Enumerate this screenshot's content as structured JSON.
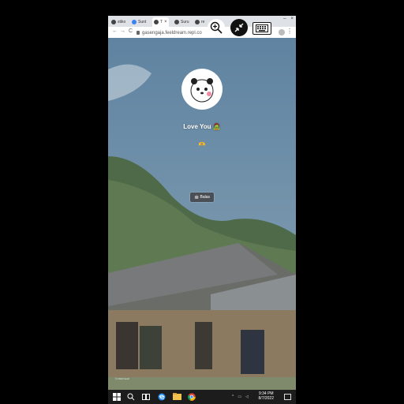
{
  "browser": {
    "tabs": [
      {
        "label": "stiko",
        "icon": "github-icon"
      },
      {
        "label": "Sunt",
        "icon": "chrome-icon"
      },
      {
        "label": "T",
        "icon": "replit-icon",
        "active": true
      },
      {
        "label": "Suru",
        "icon": "replit-icon"
      },
      {
        "label": "re",
        "icon": "replit-icon"
      }
    ],
    "address": "gasengaja.feeldream.repl.co",
    "nav": {
      "back": "←",
      "forward": "→",
      "reload": "C"
    }
  },
  "profile": {
    "name": "Love You 🧟",
    "emoji_line": "🫶",
    "link_button": "🤖 Balas"
  },
  "page": {
    "credit": "© 2022 Kasih"
  },
  "taskbar": {
    "time": "9:34 PM",
    "date": "8/7/2022"
  },
  "colors": {
    "sky": "#6f8fa6",
    "mountain": "#4f6a4a",
    "roof": "#6b6d6a",
    "button": "#4a4f55"
  }
}
